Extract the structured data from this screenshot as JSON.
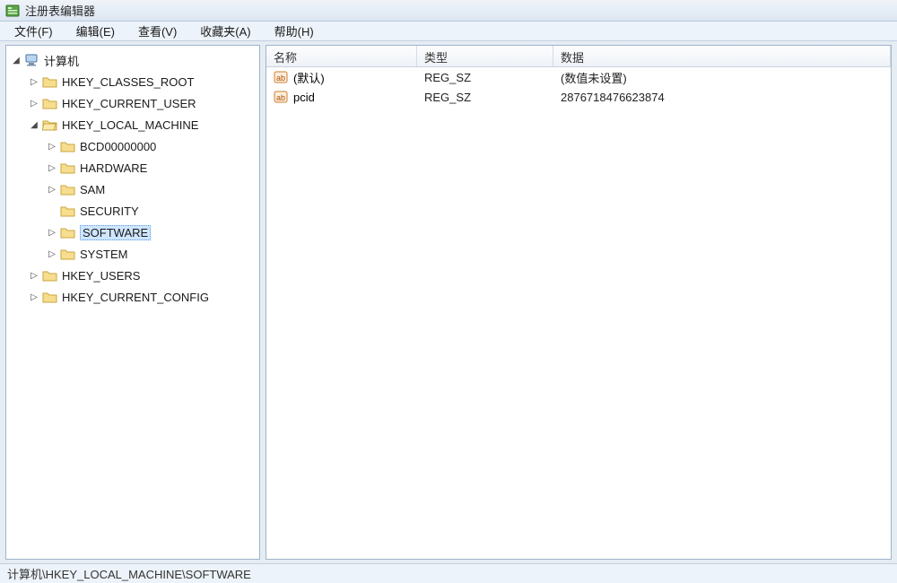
{
  "window": {
    "title": "注册表编辑器"
  },
  "menu": {
    "file": "文件(F)",
    "edit": "编辑(E)",
    "view": "查看(V)",
    "favorites": "收藏夹(A)",
    "help": "帮助(H)"
  },
  "tree": {
    "root": "计算机",
    "hives": {
      "classes_root": "HKEY_CLASSES_ROOT",
      "current_user": "HKEY_CURRENT_USER",
      "local_machine": "HKEY_LOCAL_MACHINE",
      "users": "HKEY_USERS",
      "current_config": "HKEY_CURRENT_CONFIG"
    },
    "local_machine_children": {
      "bcd": "BCD00000000",
      "hardware": "HARDWARE",
      "sam": "SAM",
      "security": "SECURITY",
      "software": "SOFTWARE",
      "system": "SYSTEM"
    }
  },
  "columns": {
    "name": "名称",
    "type": "类型",
    "data": "数据"
  },
  "values": [
    {
      "name": "(默认)",
      "type": "REG_SZ",
      "data": "(数值未设置)"
    },
    {
      "name": "pcid",
      "type": "REG_SZ",
      "data": "2876718476623874"
    }
  ],
  "statusbar": {
    "path": "计算机\\HKEY_LOCAL_MACHINE\\SOFTWARE"
  }
}
